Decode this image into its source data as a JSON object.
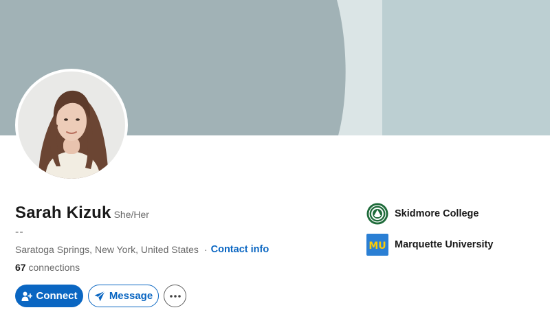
{
  "profile": {
    "name": "Sarah Kizuk",
    "pronouns": "She/Her",
    "headline": "--",
    "location": "Saratoga Springs, New York, United States",
    "separator": "·",
    "contact_label": "Contact info",
    "connections_count": "67",
    "connections_label": "connections"
  },
  "actions": {
    "connect_label": "Connect",
    "message_label": "Message",
    "more_icon": "more-horizontal-icon"
  },
  "education": [
    {
      "name": "Skidmore College",
      "logo": "skidmore-seal-logo",
      "logo_color": "#1e6b3a"
    },
    {
      "name": "Marquette University",
      "logo": "mu-logo",
      "logo_color": "#2a7fd4",
      "logo_text": "MU"
    }
  ],
  "colors": {
    "accent": "#0a66c2",
    "banner_dark": "#a1b2b6",
    "banner_light": "#dbe5e6",
    "banner_mid": "#bccfd2"
  }
}
